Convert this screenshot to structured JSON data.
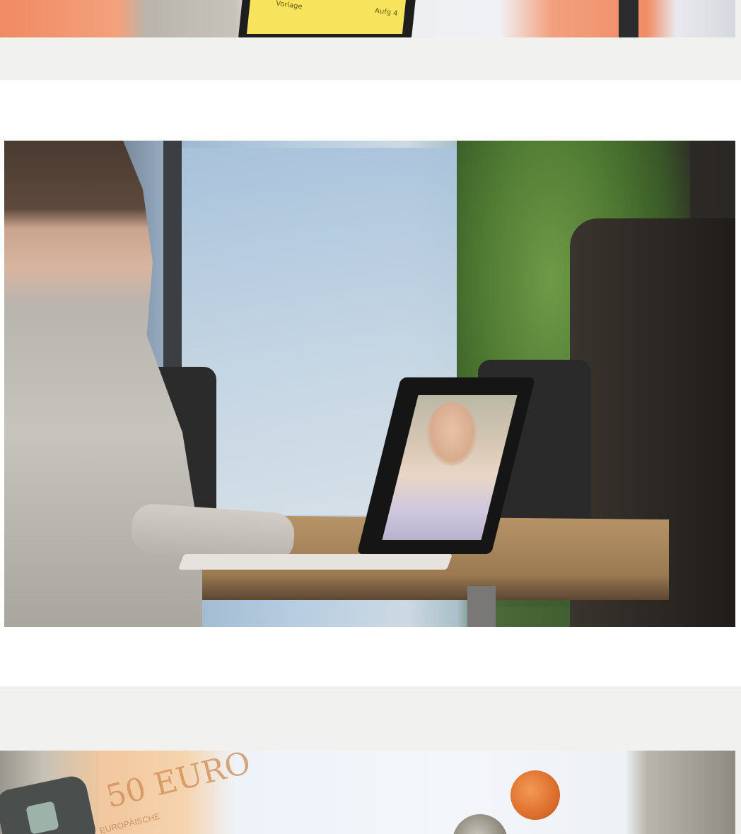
{
  "images": {
    "top": {
      "description_label": "",
      "note_text": "Vorlage",
      "note_text2": "Aufg 4"
    },
    "middle": {
      "description_label": ""
    },
    "bottom": {
      "note_text": "50 EURO",
      "note_small": "EUROPÄISCHE"
    }
  },
  "colors": {
    "page_background": "#f1f1f0",
    "white_band": "#ffffff"
  }
}
